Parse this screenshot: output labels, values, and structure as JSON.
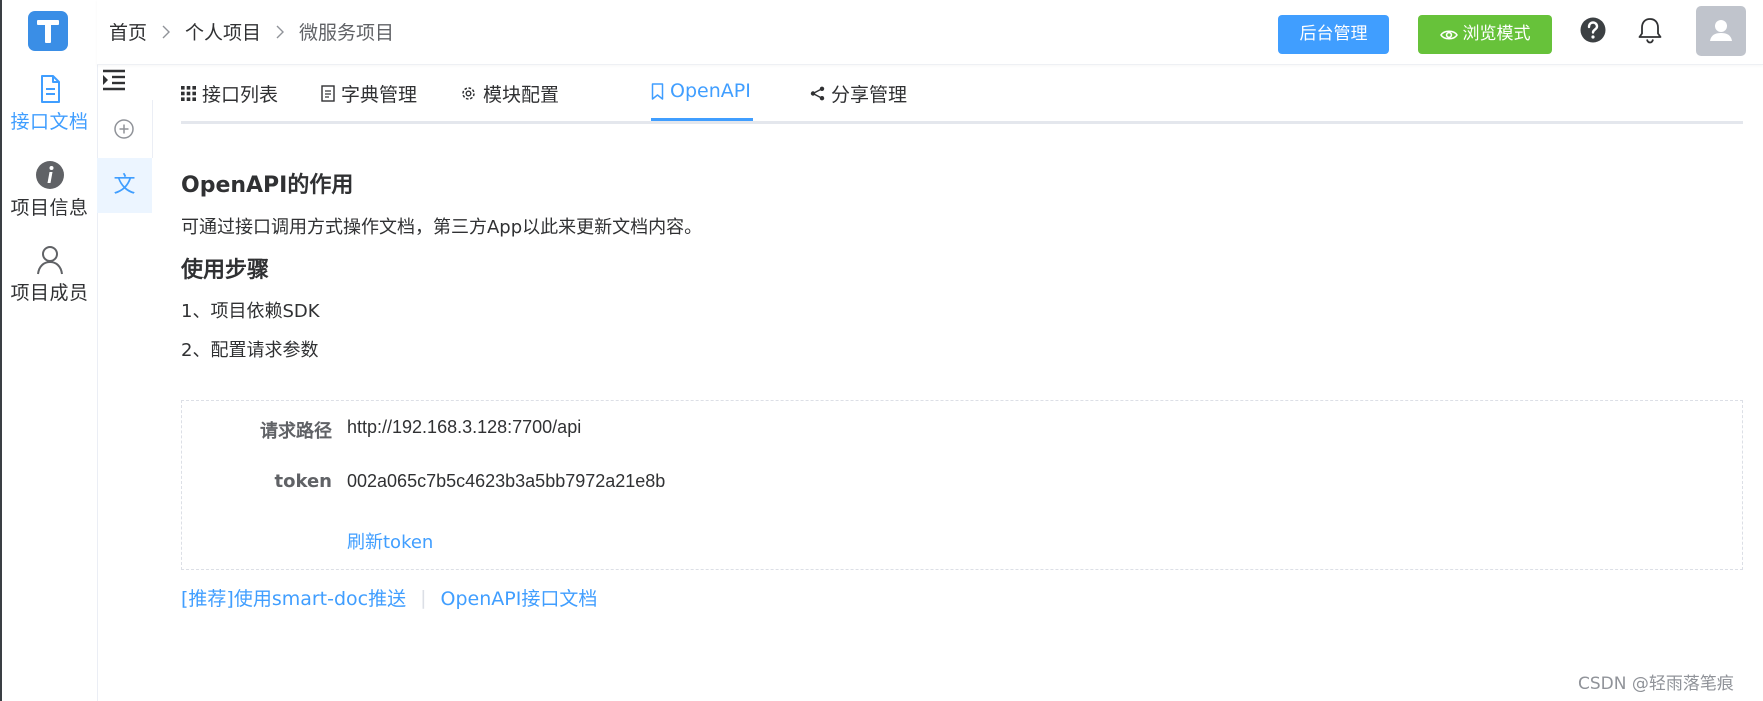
{
  "nav": {
    "items": [
      {
        "label": "接口文档",
        "icon": "document-icon",
        "active": true
      },
      {
        "label": "项目信息",
        "icon": "info-icon",
        "active": false
      },
      {
        "label": "项目成员",
        "icon": "user-icon",
        "active": false
      }
    ]
  },
  "subnav": {
    "doc_label": "文"
  },
  "header": {
    "breadcrumb": [
      "首页",
      "个人项目",
      "微服务项目"
    ],
    "admin_button": "后台管理",
    "browse_button": "浏览模式"
  },
  "tabs": [
    {
      "label": "接口列表",
      "icon": "grid-icon"
    },
    {
      "label": "字典管理",
      "icon": "file-icon"
    },
    {
      "label": "模块配置",
      "icon": "gear-icon"
    },
    {
      "label": "OpenAPI",
      "icon": "bookmark-icon",
      "active": true
    },
    {
      "label": "分享管理",
      "icon": "share-icon"
    }
  ],
  "content": {
    "title": "OpenAPI的作用",
    "description": "可通过接口调用方式操作文档，第三方App以此来更新文档内容。",
    "steps_title": "使用步骤",
    "step1": "1、项目依赖SDK",
    "step2": "2、配置请求参数",
    "request_path_label": "请求路径",
    "request_path_value": "http://192.168.3.128:7700/api",
    "token_label": "token",
    "token_value": "002a065c7b5c4623b3a5bb7972a21e8b",
    "refresh_token": "刷新token",
    "link_push": "[推荐]使用smart-doc推送",
    "link_sep": "|",
    "link_doc": "OpenAPI接口文档"
  },
  "watermark": "CSDN @轻雨落笔痕",
  "colors": {
    "primary": "#409eff",
    "success": "#67c23a",
    "logo": "#3a8ee6",
    "avatar": "#c0c4cc"
  }
}
